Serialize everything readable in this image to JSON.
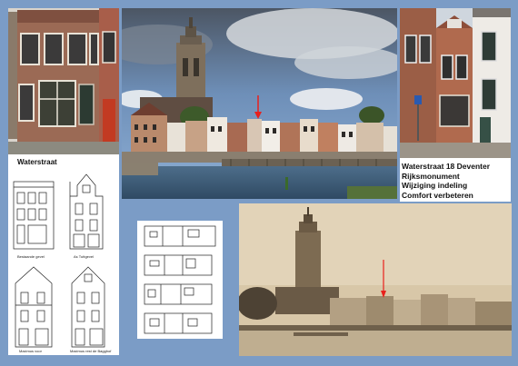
{
  "labels": {
    "street_label": "Waterstraat"
  },
  "info": {
    "line1": "Waterstraat 18 Deventer",
    "line2": "Rijksmonument",
    "line3": "Wijziging indeling",
    "line4": "Comfort verbeteren"
  },
  "drawings": {
    "caption1": "Bestaande gevel",
    "caption2": "As Tuttgevel",
    "caption3": "Maximus voor",
    "caption4": "Maximus rest de Bagghof"
  },
  "colors": {
    "background": "#7b9cc6",
    "accent_arrow": "#e8201c"
  }
}
